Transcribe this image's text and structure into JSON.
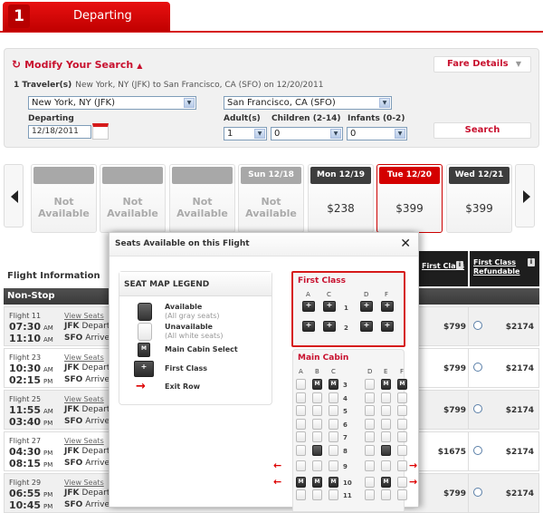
{
  "header": {
    "step_number": "1",
    "step_label": "Departing"
  },
  "search": {
    "modify_label": "Modify Your Search",
    "fare_details_label": "Fare Details",
    "travelers_label": "1 Traveler(s)",
    "route_summary": "New York, NY (JFK) to San Francisco, CA (SFO) on 12/20/2011",
    "origin": "New York, NY (JFK)",
    "destination": "San Francisco, CA (SFO)",
    "departing_label": "Departing",
    "departing_value": "12/18/2011",
    "adults_label": "Adult(s)",
    "adults_value": "1",
    "children_label": "Children (2-14)",
    "children_value": "0",
    "infants_label": "Infants (0-2)",
    "infants_value": "0",
    "search_button": "Search"
  },
  "date_strip": {
    "days": [
      {
        "label": "",
        "price": "Not Available",
        "available": false
      },
      {
        "label": "",
        "price": "Not Available",
        "available": false
      },
      {
        "label": "",
        "price": "Not Available",
        "available": false
      },
      {
        "label": "Sun 12/18",
        "price": "Not Available",
        "available": false
      },
      {
        "label": "Mon 12/19",
        "price": "$238",
        "available": true
      },
      {
        "label": "Tue 12/20",
        "price": "$399",
        "available": true,
        "selected": true
      },
      {
        "label": "Wed 12/21",
        "price": "$399",
        "available": true
      }
    ]
  },
  "flights": {
    "section_label": "Flight Information",
    "group_label": "Non-Stop",
    "col_first_class": "First Class",
    "col_first_refundable_1": "First Class",
    "col_first_refundable_2": "Refundable",
    "view_seats": "View Seats",
    "rows": [
      {
        "flight": "Flight 11",
        "dep_time": "07:30",
        "dep_ampm": "AM",
        "arr_time": "11:10",
        "arr_ampm": "AM",
        "dep_code": "JFK",
        "dep_text": "Depart",
        "arr_code": "SFO",
        "arr_text": "Arrive",
        "first": "$799",
        "refundable": "$2174"
      },
      {
        "flight": "Flight 23",
        "dep_time": "10:30",
        "dep_ampm": "AM",
        "arr_time": "02:15",
        "arr_ampm": "PM",
        "dep_code": "JFK",
        "dep_text": "Depart",
        "arr_code": "SFO",
        "arr_text": "Arrive",
        "first": "$799",
        "refundable": "$2174"
      },
      {
        "flight": "Flight 25",
        "dep_time": "11:55",
        "dep_ampm": "AM",
        "arr_time": "03:40",
        "arr_ampm": "PM",
        "dep_code": "JFK",
        "dep_text": "Depart",
        "arr_code": "SFO",
        "arr_text": "Arrive",
        "first": "$799",
        "refundable": "$2174"
      },
      {
        "flight": "Flight 27",
        "dep_time": "04:30",
        "dep_ampm": "PM",
        "arr_time": "08:15",
        "arr_ampm": "PM",
        "dep_code": "JFK",
        "dep_text": "Depart",
        "arr_code": "SFO",
        "arr_text": "Arrive",
        "first": "$1675",
        "refundable": "$2174"
      },
      {
        "flight": "Flight 29",
        "dep_time": "06:55",
        "dep_ampm": "PM",
        "arr_time": "10:45",
        "arr_ampm": "PM",
        "dep_code": "JFK",
        "dep_text": "Depart",
        "arr_code": "SFO",
        "arr_text": "Arrive",
        "first": "$799",
        "refundable": "$2174"
      }
    ]
  },
  "modal": {
    "title": "Seats Available on this Flight",
    "close": "✕",
    "legend_title": "SEAT MAP LEGEND",
    "legend": [
      {
        "label": "Available",
        "sub": "(All gray seats)"
      },
      {
        "label": "Unavailable",
        "sub": "(All white seats)"
      },
      {
        "label": "Main Cabin Select",
        "sub": ""
      },
      {
        "label": "First Class",
        "sub": ""
      },
      {
        "label": "Exit Row",
        "sub": ""
      }
    ],
    "first_class": {
      "title": "First Class",
      "columns": [
        "A",
        "C",
        "D",
        "F"
      ],
      "rows": [
        {
          "num": "1",
          "seats": [
            "F",
            "F",
            "F",
            "F"
          ]
        },
        {
          "num": "2",
          "seats": [
            "F",
            "F",
            "F",
            "F"
          ]
        }
      ]
    },
    "main_cabin": {
      "title": "Main Cabin",
      "columns": [
        "A",
        "B",
        "C",
        "D",
        "E",
        "F"
      ],
      "rows": [
        {
          "num": "3",
          "seats": [
            "U",
            "M",
            "M",
            "U",
            "M",
            "M"
          ],
          "exit": false
        },
        {
          "num": "4",
          "seats": [
            "U",
            "U",
            "U",
            "U",
            "U",
            "U"
          ],
          "exit": false
        },
        {
          "num": "5",
          "seats": [
            "U",
            "U",
            "U",
            "U",
            "U",
            "U"
          ],
          "exit": false
        },
        {
          "num": "6",
          "seats": [
            "U",
            "U",
            "U",
            "U",
            "U",
            "U"
          ],
          "exit": false
        },
        {
          "num": "7",
          "seats": [
            "U",
            "U",
            "U",
            "U",
            "U",
            "U"
          ],
          "exit": false
        },
        {
          "num": "8",
          "seats": [
            "U",
            "A",
            "U",
            "U",
            "A",
            "U"
          ],
          "exit": false
        },
        {
          "num": "9",
          "seats": [
            "U",
            "U",
            "U",
            "U",
            "U",
            "U"
          ],
          "exit": true
        },
        {
          "num": "10",
          "seats": [
            "M",
            "M",
            "M",
            "U",
            "M",
            "U"
          ],
          "exit": true
        },
        {
          "num": "11",
          "seats": [
            "U",
            "U",
            "U",
            "U",
            "U",
            "U"
          ],
          "exit": false
        }
      ]
    }
  }
}
